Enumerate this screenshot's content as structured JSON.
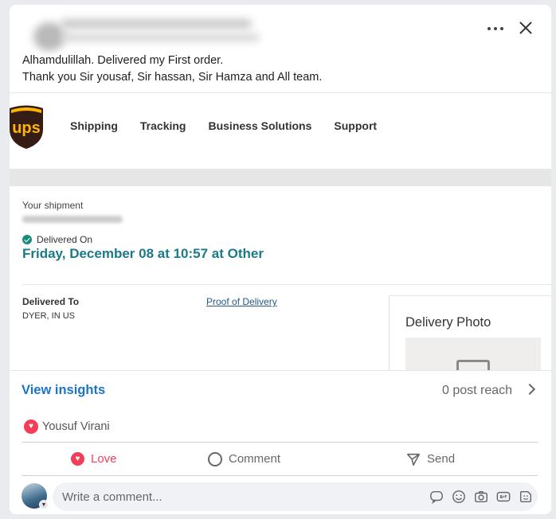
{
  "post": {
    "text": "Alhamdulillah. Delivered my First order.\nThank you Sir yousaf, Sir hassan, Sir Hamza and All team."
  },
  "embed": {
    "logo_text": "ups",
    "nav": [
      "Shipping",
      "Tracking",
      "Business Solutions",
      "Support"
    ],
    "shipment_label": "Your shipment",
    "status_label": "Delivered On",
    "delivered_date": "Friday, December 08 at 10:57 at Other",
    "delivered_to_label": "Delivered To",
    "delivered_to_value": "DYER, IN US",
    "proof_link": "Proof of Delivery",
    "photo_title": "Delivery Photo"
  },
  "insights": {
    "view_label": "View insights",
    "reach": "0 post reach"
  },
  "reactions": {
    "reactor": "Yousuf Virani"
  },
  "actions": {
    "love": "Love",
    "comment": "Comment",
    "send": "Send"
  },
  "composer": {
    "placeholder": "Write a comment..."
  },
  "colors": {
    "ups_brown": "#351c15",
    "ups_gold": "#ffb500",
    "link_blue": "#1b74c5",
    "love_red": "#f33e58"
  },
  "icons": [
    "more-icon",
    "close-icon",
    "check-icon",
    "image-placeholder-icon",
    "chevron-right-icon",
    "heart-icon",
    "comment-icon",
    "send-icon",
    "sticker-icon",
    "emoji-icon",
    "camera-icon",
    "gif-icon",
    "avatar-sticker-icon"
  ]
}
